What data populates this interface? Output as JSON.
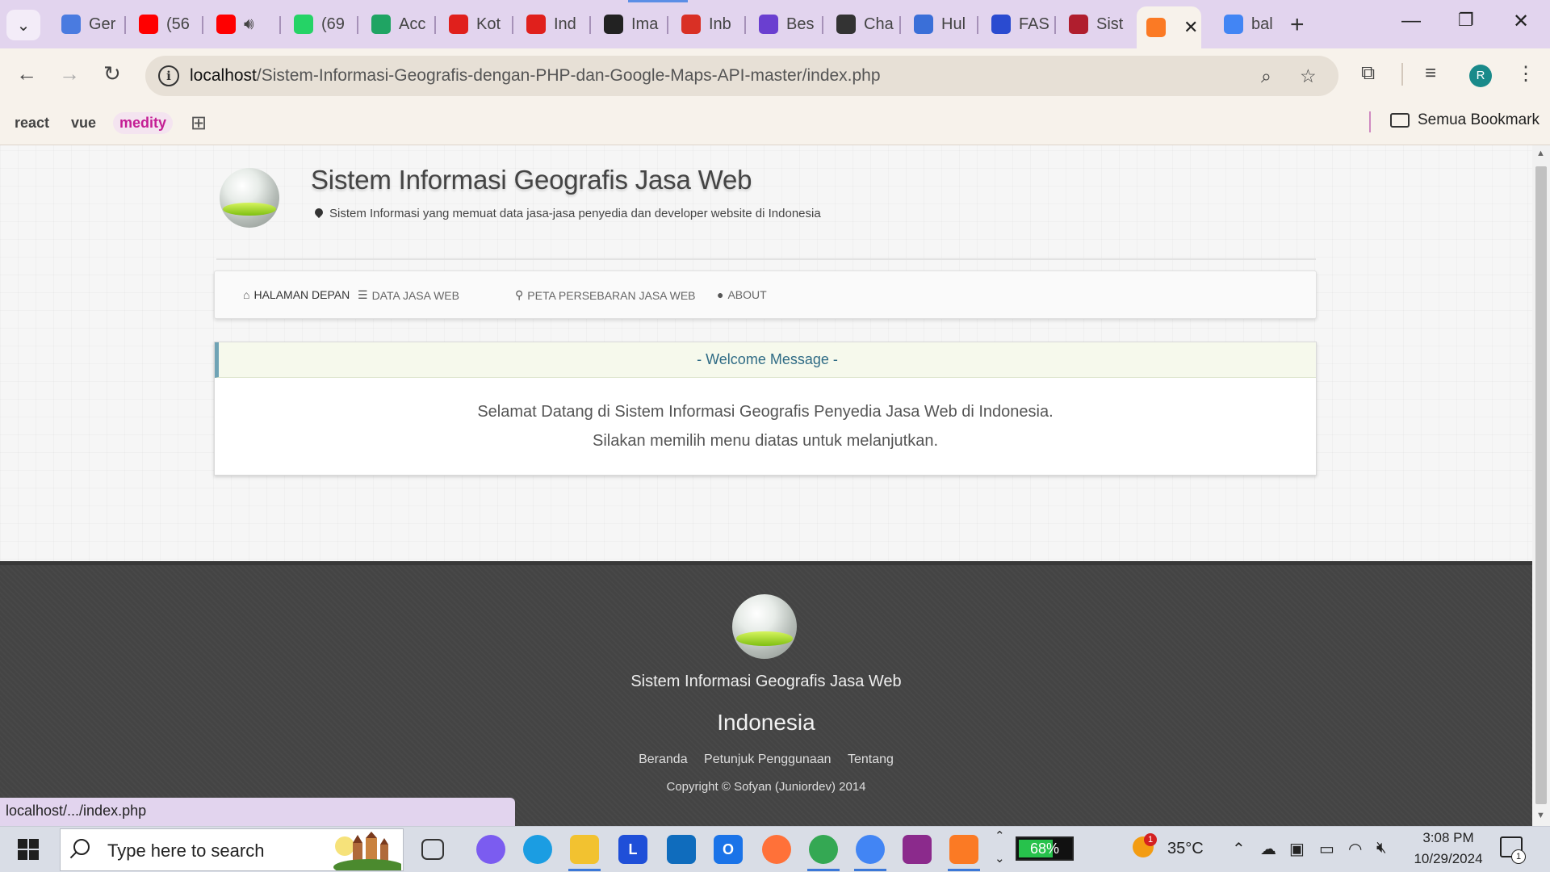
{
  "browser": {
    "tabs": [
      {
        "label": "Ger",
        "icon": "gemini-icon",
        "color": "#4a7be0"
      },
      {
        "label": "(56",
        "icon": "youtube-icon",
        "color": "#ff0000"
      },
      {
        "label": "",
        "icon": "youtube-icon",
        "color": "#ff0000",
        "audio": true
      },
      {
        "label": "(69",
        "icon": "whatsapp-icon",
        "color": "#25d366"
      },
      {
        "label": "Acc",
        "icon": "google-drive-icon",
        "color": "#1fa463"
      },
      {
        "label": "Kot",
        "icon": "red-cross-icon",
        "color": "#e0201c"
      },
      {
        "label": "Ind",
        "icon": "red-cross-icon",
        "color": "#e0201c"
      },
      {
        "label": "Ima",
        "icon": "dark-circle-icon",
        "color": "#222222"
      },
      {
        "label": "Inb",
        "icon": "gmail-icon",
        "color": "#d93025"
      },
      {
        "label": "Bes",
        "icon": "gear-icon",
        "color": "#6a3fd0"
      },
      {
        "label": "Cha",
        "icon": "openai-icon",
        "color": "#333333"
      },
      {
        "label": "Hul",
        "icon": "stack-icon",
        "color": "#3a6fd8"
      },
      {
        "label": "FAS",
        "icon": "fas-icon",
        "color": "#2a4bd0"
      },
      {
        "label": "Sist",
        "icon": "bug-icon",
        "color": "#b01e2e"
      },
      {
        "label": "",
        "icon": "xampp-icon",
        "color": "#fb7a24",
        "active": true
      },
      {
        "label": "bal",
        "icon": "google-icon",
        "color": "#4285f4"
      }
    ],
    "url_host": "localhost",
    "url_path": "/Sistem-Informasi-Geografis-dengan-PHP-dan-Google-Maps-API-master/index.php",
    "bookmarks": [
      "react",
      "vue",
      "medity"
    ],
    "bookmark_folder": "Semua Bookmark",
    "profile_initial": "R",
    "status_url": "localhost/.../index.php"
  },
  "site": {
    "title": "Sistem Informasi Geografis Jasa Web",
    "subtitle": "Sistem Informasi yang memuat data jasa-jasa penyedia dan developer website di Indonesia",
    "nav": [
      {
        "label": "HALAMAN DEPAN",
        "icon": "home-icon",
        "active": true
      },
      {
        "label": "DATA JASA WEB",
        "icon": "list-icon"
      },
      {
        "label": "PETA PERSEBARAN JASA WEB",
        "icon": "map-marker-icon"
      },
      {
        "label": "ABOUT",
        "icon": "user-icon"
      }
    ],
    "panel_title": "- Welcome Message -",
    "panel_line1": "Selamat Datang di Sistem Informasi Geografis Penyedia Jasa Web di Indonesia.",
    "panel_line2": "Silakan memilih menu diatas untuk melanjutkan.",
    "footer_title": "Sistem Informasi Geografis Jasa Web",
    "footer_country": "Indonesia",
    "footer_links": [
      "Beranda",
      "Petunjuk Penggunaan",
      "Tentang"
    ],
    "footer_copy": "Copyright © Sofyan (Juniordev) 2014"
  },
  "taskbar": {
    "search_placeholder": "Type here to search",
    "battery_percent": 68,
    "battery_label": "68%",
    "temperature": "35°C",
    "weather_badge": "1",
    "time": "3:08 PM",
    "date": "10/29/2024",
    "notification_count": "1",
    "apps": [
      {
        "name": "task-view-icon",
        "label": "",
        "color": "transparent"
      },
      {
        "name": "copilot-icon",
        "label": "",
        "color": "#7b5cf0"
      },
      {
        "name": "edge-icon",
        "label": "",
        "color": "#1b9de2"
      },
      {
        "name": "file-explorer-icon",
        "label": "",
        "color": "#f2c230"
      },
      {
        "name": "lens-app-icon",
        "label": "L",
        "color": "#1f4fd8"
      },
      {
        "name": "outlook-icon",
        "label": "",
        "color": "#0f6cbd"
      },
      {
        "name": "blue-square-app-icon",
        "label": "O",
        "color": "#1a73e8"
      },
      {
        "name": "firefox-icon",
        "label": "",
        "color": "#ff7139"
      },
      {
        "name": "chrome-icon",
        "label": "",
        "color": "#34a853"
      },
      {
        "name": "chrome-profile-icon",
        "label": "",
        "color": "#4285f4"
      },
      {
        "name": "winrar-icon",
        "label": "",
        "color": "#8b2a8c"
      },
      {
        "name": "xampp-icon",
        "label": "",
        "color": "#fb7a24"
      }
    ]
  }
}
